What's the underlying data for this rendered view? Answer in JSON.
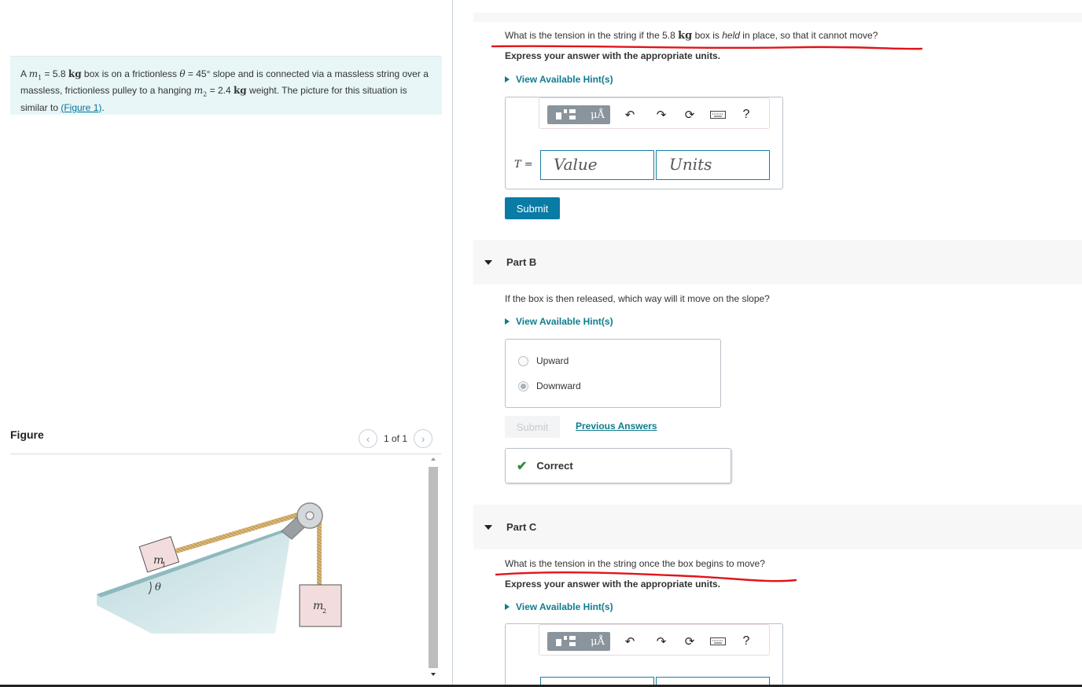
{
  "problem": {
    "text_pre": "A",
    "m1_sym": "m",
    "m1_sub": "1",
    "m1_val": " = 5.8 ",
    "kg1": "kg",
    "text_mid1": " box is on a frictionless ",
    "theta": "θ",
    "angle_val": " = 45° slope and is connected via a massless string over a massless, frictionless pulley to a hanging ",
    "m2_sym": "m",
    "m2_sub": "2",
    "m2_val": " = 2.4 ",
    "kg2": "kg",
    "text_end": " weight. The picture for this situation is similar to ",
    "figure_link": "(Figure 1)",
    "period": "."
  },
  "figure": {
    "title": "Figure",
    "pager": "1 of 1",
    "m1_label": "m",
    "m1_sub": "1",
    "m2_label": "m",
    "m2_sub": "2",
    "theta_label": "θ"
  },
  "partA": {
    "question_pre": "What is the tension in the string if the 5.8 ",
    "question_kg": "kg",
    "question_mid": " box is ",
    "question_em": "held",
    "question_post": " in place, so that it cannot move?",
    "express": "Express your answer with the appropriate units.",
    "hint": "View Available Hint(s)",
    "var_label": "T =",
    "value_placeholder": "Value",
    "units_placeholder": "Units",
    "submit": "Submit"
  },
  "toolbar": {
    "mu_label": "μÅ",
    "help_label": "?"
  },
  "partB": {
    "title": "Part B",
    "question": "If the box is then released, which way will it move on the slope?",
    "hint": "View Available Hint(s)",
    "options": [
      {
        "label": "Upward",
        "selected": false
      },
      {
        "label": "Downward",
        "selected": true
      }
    ],
    "submit": "Submit",
    "previous_answers": "Previous Answers",
    "feedback": "Correct"
  },
  "partC": {
    "title": "Part C",
    "question": "What is the tension in the string once the box begins to move?",
    "express": "Express your answer with the appropriate units.",
    "hint": "View Available Hint(s)"
  },
  "colors": {
    "accent": "#0a7ba5",
    "hint": "#0e7c8e",
    "correct": "#2f8a3a",
    "annotation": "#e0151b"
  }
}
